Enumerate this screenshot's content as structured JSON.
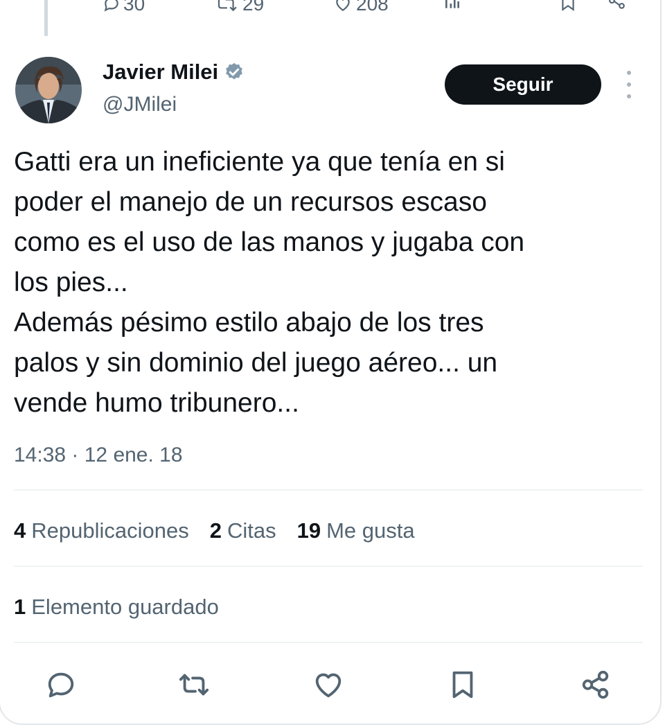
{
  "previous_tweet_actions": {
    "replies": "30",
    "reposts": "29",
    "likes": "208"
  },
  "author": {
    "name": "Javier Milei",
    "handle": "@JMilei",
    "verified_color": "#829aab"
  },
  "follow_label": "Seguir",
  "tweet_text": "Gatti era un ineficiente ya que tenía en si\npoder el manejo de un recursos escaso\ncomo es el uso de las manos y jugaba con\nlos pies...\nAdemás pésimo estilo abajo de los tres\npalos y sin dominio del juego aéreo... un\nvende humo tribunero...",
  "timestamp": "14:38 · 12 ene. 18",
  "stats": {
    "reposts_count": "4",
    "reposts_label": "Republicaciones",
    "quotes_count": "2",
    "quotes_label": "Citas",
    "likes_count": "19",
    "likes_label": "Me gusta"
  },
  "bookmarks": {
    "count": "1",
    "label": "Elemento guardado"
  },
  "icons": {
    "reply": "reply-icon",
    "repost": "repost-icon",
    "like": "heart-icon",
    "bookmark": "bookmark-icon",
    "share": "share-icon",
    "more": "more-icon",
    "verified": "verified-badge-icon",
    "views": "views-icon"
  },
  "colors": {
    "text": "#0f1419",
    "secondary": "#536471",
    "button": "#0f1419",
    "divider": "#eff3f4"
  }
}
